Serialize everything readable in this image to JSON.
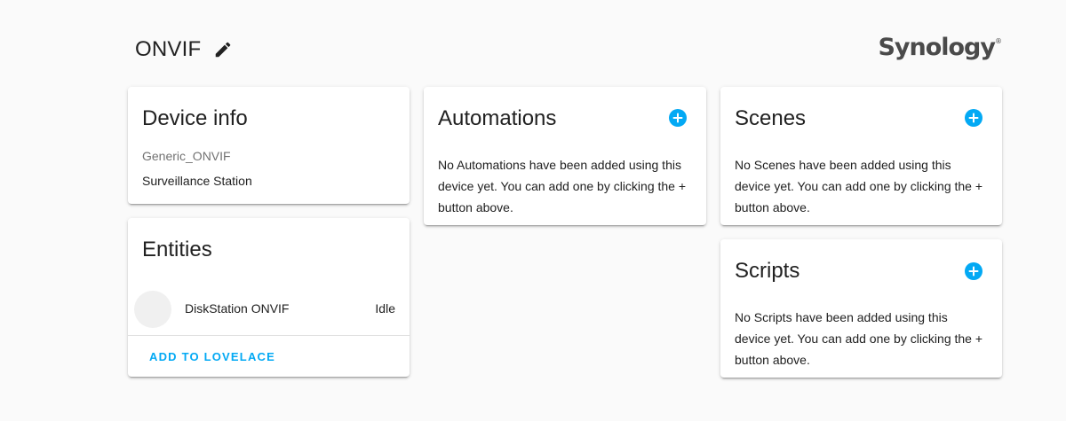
{
  "header": {
    "title": "ONVIF",
    "edit_icon": "pencil-icon",
    "brand": "Synology",
    "brand_mark": "®"
  },
  "device_info": {
    "title": "Device info",
    "model": "Generic_ONVIF",
    "manufacturer": "Surveillance Station"
  },
  "entities": {
    "title": "Entities",
    "items": [
      {
        "name": "DiskStation ONVIF",
        "state": "Idle"
      }
    ],
    "action_label": "ADD TO LOVELACE"
  },
  "automations": {
    "title": "Automations",
    "empty_text": "No Automations have been added using this device yet. You can add one by clicking the + button above."
  },
  "scenes": {
    "title": "Scenes",
    "empty_text": "No Scenes have been added using this device yet. You can add one by clicking the + button above."
  },
  "scripts": {
    "title": "Scripts",
    "empty_text": "No Scripts have been added using this device yet. You can add one by clicking the + button above."
  },
  "colors": {
    "accent": "#03a9f4",
    "background": "#fafafa",
    "card": "#ffffff"
  }
}
